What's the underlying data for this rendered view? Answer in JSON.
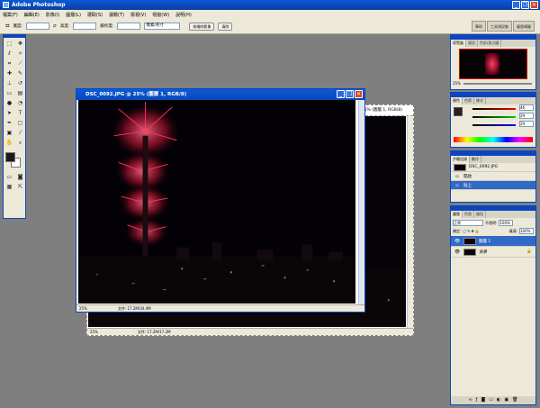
{
  "app": {
    "title": "Adobe Photoshop"
  },
  "window_buttons": {
    "minimize": "_",
    "restore": "❐",
    "close": "✕"
  },
  "menu": [
    "檔案(F)",
    "編輯(E)",
    "影像(I)",
    "圖層(L)",
    "選取(S)",
    "濾鏡(T)",
    "檢視(V)",
    "視窗(W)",
    "說明(H)"
  ],
  "options": {
    "width_label": "寬度:",
    "height_label": "高度:",
    "resolution_label": "解析度:",
    "unit": "像素/英寸",
    "front_image_button": "前端的影像",
    "clear_button": "清除"
  },
  "palette_wells": [
    "筆刷",
    "工具預設集",
    "圖層構圖"
  ],
  "doc_front": {
    "title": "DSC_0092.JPG @ 25% (圖層 1, RGB/8)",
    "zoom": "25%",
    "doc_info": "文件: 17.2M/34.4M"
  },
  "doc_back": {
    "title": "F:\\image\\處理過\\收錄\\071231跨年\\縮\\DSC_0092.JPG @ 25% (圖層 1, RGB/8)",
    "zoom": "25%",
    "doc_info": "文件: 17.2M/17.2M"
  },
  "navigator": {
    "tabs": [
      "導覽器",
      "資訊",
      "色彩/直方圖"
    ],
    "zoom": "25%"
  },
  "color_panel": {
    "tabs": [
      "顏色",
      "色票",
      "樣式"
    ],
    "r": "46",
    "g": "29",
    "b": "29"
  },
  "history": {
    "tabs": [
      "步驟記錄",
      "動作"
    ],
    "snapshot": "DSC_0092.JPG",
    "items": [
      "開啟",
      "貼上"
    ]
  },
  "layers": {
    "tabs": [
      "圖層",
      "色版",
      "路徑"
    ],
    "blend_mode": "正常",
    "opacity_label": "不透明:",
    "opacity": "100%",
    "lock_label": "鎖定:",
    "fill_label": "填滿:",
    "fill": "100%",
    "items": [
      {
        "name": "圖層 1",
        "selected": true
      },
      {
        "name": "背景",
        "selected": false
      }
    ]
  },
  "colors": {
    "accent": "#0a46c0",
    "selection": "#3169c6",
    "background": "#7f7f7f"
  }
}
